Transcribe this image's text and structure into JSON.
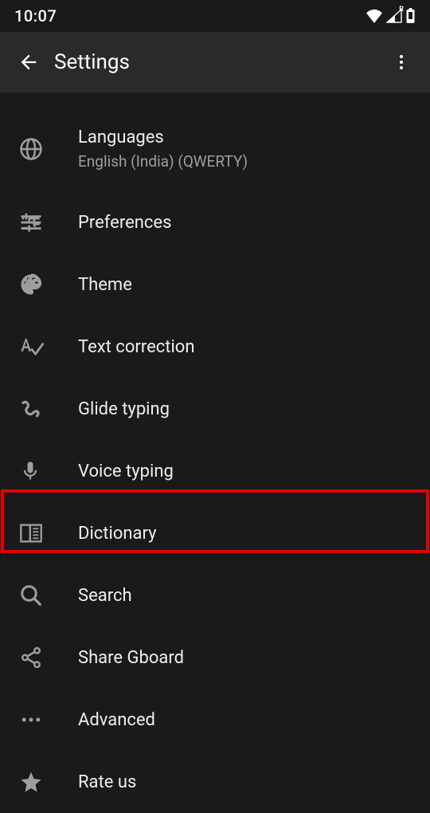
{
  "statusbar": {
    "time": "10:07"
  },
  "appbar": {
    "title": "Settings"
  },
  "items": [
    {
      "icon": "globe-icon",
      "title": "Languages",
      "subtitle": "English (India) (QWERTY)"
    },
    {
      "icon": "sliders-icon",
      "title": "Preferences"
    },
    {
      "icon": "palette-icon",
      "title": "Theme"
    },
    {
      "icon": "text-check-icon",
      "title": "Text correction"
    },
    {
      "icon": "glide-icon",
      "title": "Glide typing"
    },
    {
      "icon": "mic-icon",
      "title": "Voice typing"
    },
    {
      "icon": "book-icon",
      "title": "Dictionary",
      "highlight": true
    },
    {
      "icon": "search-icon",
      "title": "Search"
    },
    {
      "icon": "share-icon",
      "title": "Share Gboard"
    },
    {
      "icon": "dots-icon",
      "title": "Advanced"
    },
    {
      "icon": "star-icon",
      "title": "Rate us"
    }
  ]
}
